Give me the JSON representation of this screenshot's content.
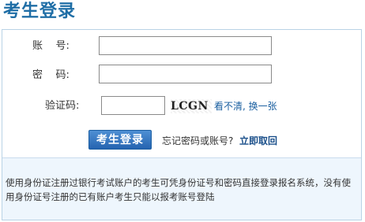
{
  "header": {
    "title": "考生登录"
  },
  "form": {
    "account_label": "账    号:",
    "password_label": "密    码:",
    "captcha_label": "验证码:",
    "account_value": "",
    "password_value": "",
    "captcha_value": "",
    "captcha_image_text": "LCGN",
    "captcha_refresh_label": "看不清, 换一张",
    "login_button_label": "考生登录",
    "forgot_prompt": "忘记密码或账号?",
    "forgot_link_label": "立即取回"
  },
  "notice": {
    "text": "使用身份证注册过银行考试账户的考生可凭身份证号和密码直接登录报名系统，没有使用身份证号注册的已有账户考生只能以报考账号登陆"
  },
  "colors": {
    "title": "#1f6ea6",
    "panel_border": "#b9d3e6",
    "button": "#2563b0",
    "link": "#1a5fa0",
    "notice_bg": "#eef6fd"
  }
}
